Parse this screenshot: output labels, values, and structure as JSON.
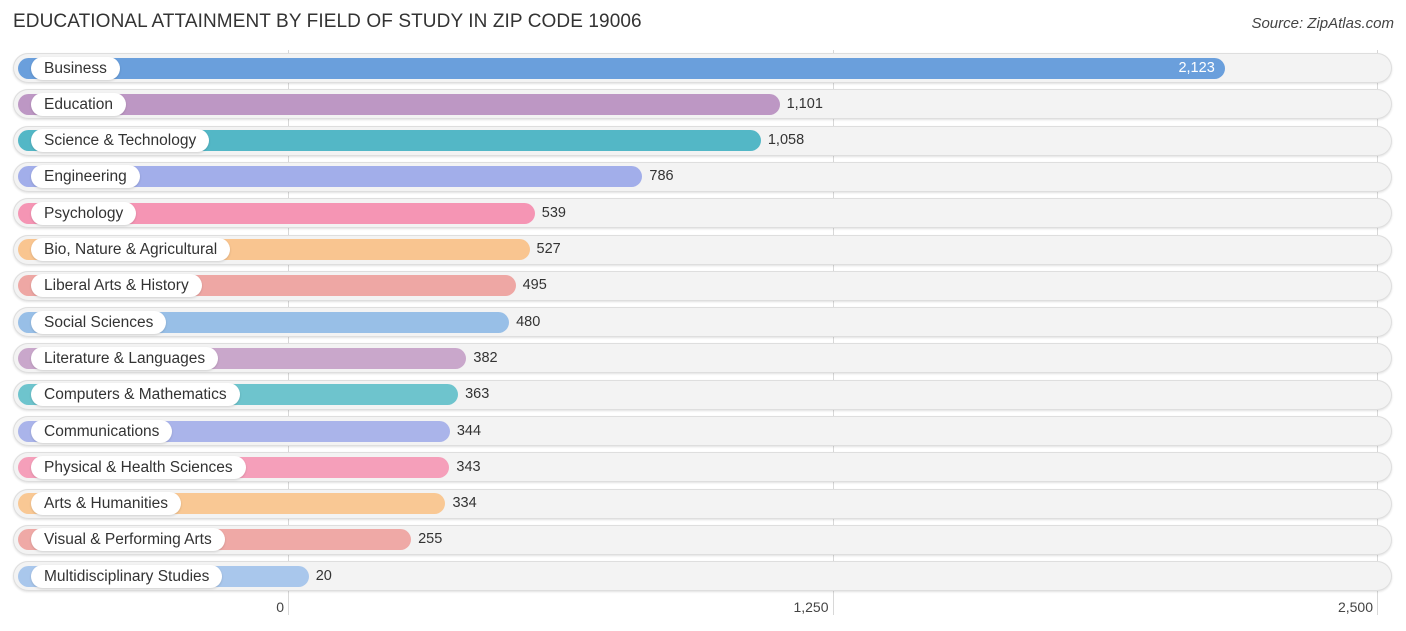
{
  "title": "EDUCATIONAL ATTAINMENT BY FIELD OF STUDY IN ZIP CODE 19006",
  "source": "Source: ZipAtlas.com",
  "chart_data": {
    "type": "bar",
    "orientation": "horizontal",
    "title": "EDUCATIONAL ATTAINMENT BY FIELD OF STUDY IN ZIP CODE 19006",
    "xlabel": "",
    "ylabel": "",
    "xlim": [
      0,
      2500
    ],
    "grid": true,
    "x_ticks": [
      0,
      1250,
      2500
    ],
    "x_tick_labels": [
      "0",
      "1,250",
      "2,500"
    ],
    "categories": [
      "Business",
      "Education",
      "Science & Technology",
      "Engineering",
      "Psychology",
      "Bio, Nature & Agricultural",
      "Liberal Arts & History",
      "Social Sciences",
      "Literature & Languages",
      "Computers & Mathematics",
      "Communications",
      "Physical & Health Sciences",
      "Arts & Humanities",
      "Visual & Performing Arts",
      "Multidisciplinary Studies"
    ],
    "values": [
      2123,
      1101,
      1058,
      786,
      539,
      527,
      495,
      480,
      382,
      363,
      344,
      343,
      334,
      255,
      20
    ],
    "value_labels": [
      "2,123",
      "1,101",
      "1,058",
      "786",
      "539",
      "527",
      "495",
      "480",
      "382",
      "363",
      "344",
      "343",
      "334",
      "255",
      "20"
    ],
    "colors": [
      "#6a9fdc",
      "#bd97c4",
      "#53b7c6",
      "#a2aeea",
      "#f595b4",
      "#f9c590",
      "#eea7a4",
      "#98bfe7",
      "#c9a7cb",
      "#6ec4cd",
      "#aab4ea",
      "#f59fba",
      "#f9c894",
      "#efa9a6",
      "#a9c7ec"
    ]
  }
}
